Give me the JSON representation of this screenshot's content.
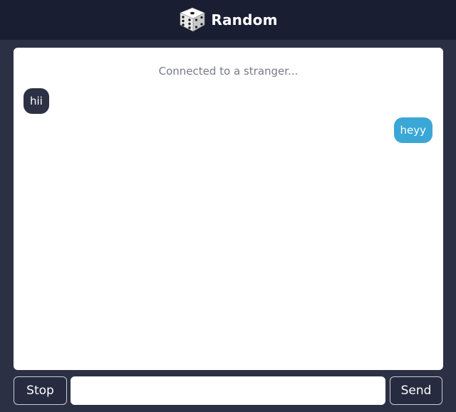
{
  "header": {
    "title": "Random",
    "logo_icon": "dice-icon"
  },
  "chat": {
    "status": "Connected to a stranger...",
    "messages": [
      {
        "from": "stranger",
        "text": "hii"
      },
      {
        "from": "me",
        "text": "heyy"
      }
    ]
  },
  "controls": {
    "stop_label": "Stop",
    "send_label": "Send",
    "input_value": "",
    "input_placeholder": ""
  },
  "colors": {
    "page_bg": "#2b3044",
    "header_bg": "#191e33",
    "stranger_bubble": "#2c3145",
    "my_bubble": "#3aa7d6"
  }
}
